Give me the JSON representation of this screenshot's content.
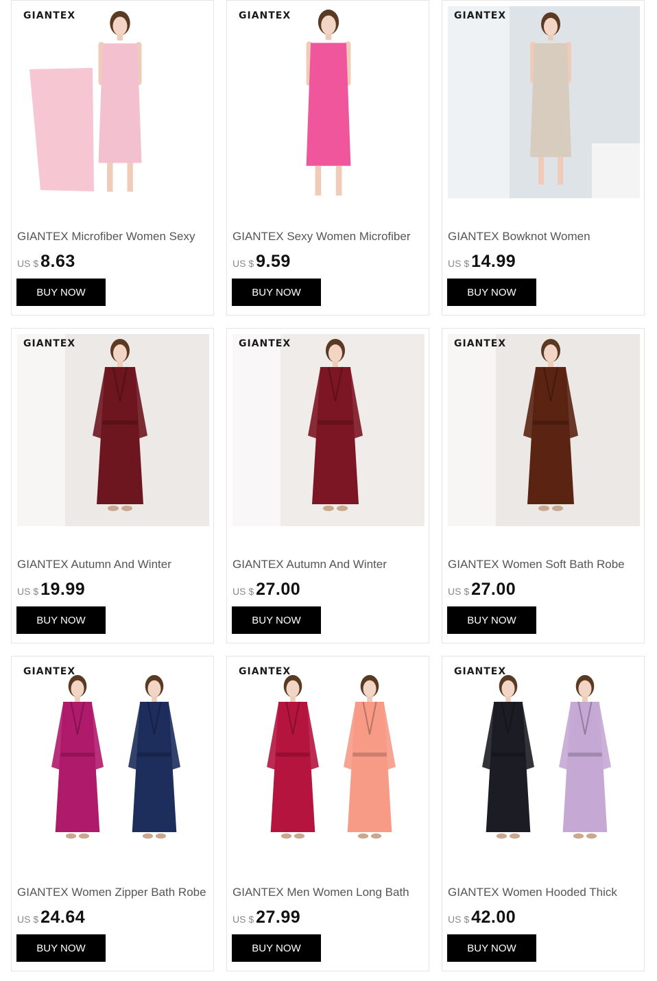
{
  "products": [
    {
      "brand": "GIANTEX",
      "title": "GIANTEX Microfiber Women Sexy",
      "currency": "US $",
      "price": "8.63",
      "button": "BUY NOW",
      "colors": [
        "#f6c6d2",
        "#f3c0cf"
      ],
      "bg": "#ffffff",
      "figure": "wrap"
    },
    {
      "brand": "GIANTEX",
      "title": "GIANTEX Sexy Women Microfiber",
      "currency": "US $",
      "price": "9.59",
      "button": "BUY NOW",
      "colors": [
        "#f0569c"
      ],
      "bg": "#ffffff",
      "figure": "wrap"
    },
    {
      "brand": "GIANTEX",
      "title": "GIANTEX Bowknot Women",
      "currency": "US $",
      "price": "14.99",
      "button": "BUY NOW",
      "colors": [
        "#d7ccbd"
      ],
      "bg": "#dde3e7",
      "figure": "wrap"
    },
    {
      "brand": "GIANTEX",
      "title": "GIANTEX Autumn And Winter",
      "currency": "US $",
      "price": "19.99",
      "button": "BUY NOW",
      "colors": [
        "#6e1620"
      ],
      "bg": "#ece9e6",
      "figure": "robe"
    },
    {
      "brand": "GIANTEX",
      "title": "GIANTEX Autumn And Winter",
      "currency": "US $",
      "price": "27.00",
      "button": "BUY NOW",
      "colors": [
        "#7c1624"
      ],
      "bg": "#efecea",
      "figure": "robe"
    },
    {
      "brand": "GIANTEX",
      "title": "GIANTEX Women Soft Bath Robe",
      "currency": "US $",
      "price": "27.00",
      "button": "BUY NOW",
      "colors": [
        "#5a2312"
      ],
      "bg": "#ebe8e6",
      "figure": "robe"
    },
    {
      "brand": "GIANTEX",
      "title": "GIANTEX Women Zipper Bath Robe",
      "currency": "US $",
      "price": "24.64",
      "button": "BUY NOW",
      "colors": [
        "#b01a6b",
        "#1d2d5c"
      ],
      "bg": "#ffffff",
      "figure": "pair"
    },
    {
      "brand": "GIANTEX",
      "title": "GIANTEX Men Women Long Bath",
      "currency": "US $",
      "price": "27.99",
      "button": "BUY NOW",
      "colors": [
        "#b5143e",
        "#f79a86"
      ],
      "bg": "#ffffff",
      "figure": "pair"
    },
    {
      "brand": "GIANTEX",
      "title": "GIANTEX Women Hooded Thick",
      "currency": "US $",
      "price": "42.00",
      "button": "BUY NOW",
      "colors": [
        "#1c1c24",
        "#c5a8d4"
      ],
      "bg": "#ffffff",
      "figure": "pair"
    }
  ]
}
